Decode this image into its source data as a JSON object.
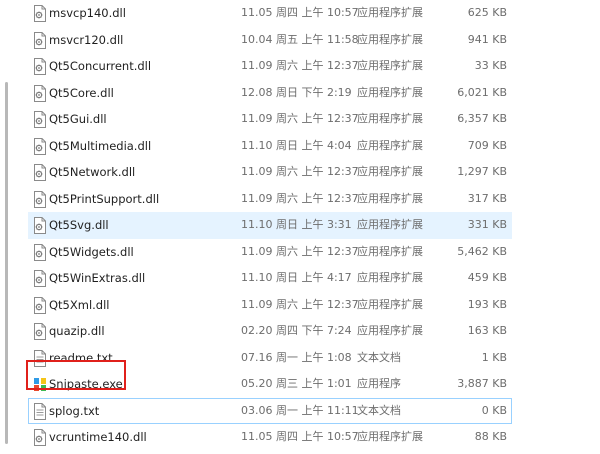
{
  "files": [
    {
      "name": "msvcp140.dll",
      "date": "11.05 周四 上午 10:57",
      "type": "应用程序扩展",
      "size": "625 KB",
      "icon": "dll-file-icon"
    },
    {
      "name": "msvcr120.dll",
      "date": "10.04 周五 上午 11:58",
      "type": "应用程序扩展",
      "size": "941 KB",
      "icon": "dll-file-icon"
    },
    {
      "name": "Qt5Concurrent.dll",
      "date": "11.09 周六 上午 12:37",
      "type": "应用程序扩展",
      "size": "33 KB",
      "icon": "dll-file-icon"
    },
    {
      "name": "Qt5Core.dll",
      "date": "12.08 周日 下午 2:19",
      "type": "应用程序扩展",
      "size": "6,021 KB",
      "icon": "dll-file-icon"
    },
    {
      "name": "Qt5Gui.dll",
      "date": "11.09 周六 上午 12:37",
      "type": "应用程序扩展",
      "size": "6,357 KB",
      "icon": "dll-file-icon"
    },
    {
      "name": "Qt5Multimedia.dll",
      "date": "11.10 周日 上午 4:04",
      "type": "应用程序扩展",
      "size": "709 KB",
      "icon": "dll-file-icon"
    },
    {
      "name": "Qt5Network.dll",
      "date": "11.09 周六 上午 12:37",
      "type": "应用程序扩展",
      "size": "1,297 KB",
      "icon": "dll-file-icon"
    },
    {
      "name": "Qt5PrintSupport.dll",
      "date": "11.09 周六 上午 12:37",
      "type": "应用程序扩展",
      "size": "317 KB",
      "icon": "dll-file-icon"
    },
    {
      "name": "Qt5Svg.dll",
      "date": "11.10 周日 上午 3:31",
      "type": "应用程序扩展",
      "size": "331 KB",
      "icon": "dll-file-icon"
    },
    {
      "name": "Qt5Widgets.dll",
      "date": "11.09 周六 上午 12:37",
      "type": "应用程序扩展",
      "size": "5,462 KB",
      "icon": "dll-file-icon"
    },
    {
      "name": "Qt5WinExtras.dll",
      "date": "11.10 周日 上午 4:17",
      "type": "应用程序扩展",
      "size": "459 KB",
      "icon": "dll-file-icon"
    },
    {
      "name": "Qt5Xml.dll",
      "date": "11.09 周六 上午 12:37",
      "type": "应用程序扩展",
      "size": "193 KB",
      "icon": "dll-file-icon"
    },
    {
      "name": "quazip.dll",
      "date": "02.20 周四 下午 7:24",
      "type": "应用程序扩展",
      "size": "163 KB",
      "icon": "dll-file-icon"
    },
    {
      "name": "readme.txt",
      "date": "07.16 周一 上午 1:08",
      "type": "文本文档",
      "size": "1 KB",
      "icon": "text-file-icon"
    },
    {
      "name": "Snipaste.exe",
      "date": "05.20 周三 上午 1:01",
      "type": "应用程序",
      "size": "3,887 KB",
      "icon": "snipaste-app-icon"
    },
    {
      "name": "splog.txt",
      "date": "03.06 周一 上午 11:11",
      "type": "文本文档",
      "size": "0 KB",
      "icon": "text-file-icon"
    },
    {
      "name": "vcruntime140.dll",
      "date": "11.05 周四 上午 10:57",
      "type": "应用程序扩展",
      "size": "88 KB",
      "icon": "dll-file-icon"
    }
  ],
  "state": {
    "selected_index": 8,
    "focused_index": 15,
    "annotated_index": 14
  },
  "colors": {
    "selection": "#e5f3ff",
    "focus_border": "#99d1ff",
    "annotation": "#e0201b"
  }
}
